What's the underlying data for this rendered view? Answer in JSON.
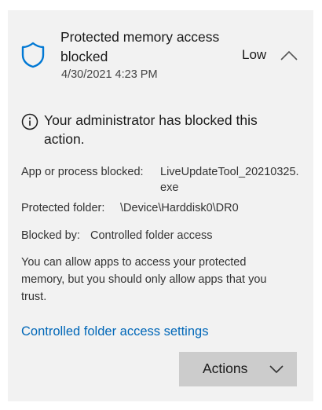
{
  "notification": {
    "title": "Protected memory access blocked",
    "timestamp": "4/30/2021 4:23 PM",
    "severity": "Low",
    "icon": "shield-icon",
    "accent_color": "#0078d4"
  },
  "notice": {
    "icon": "info-icon",
    "text": "Your administrator has blocked this action."
  },
  "details": {
    "app_label": "App or process blocked:",
    "app_value": "LiveUpdateTool_20210325.exe",
    "folder_label": "Protected folder:",
    "folder_value": "\\Device\\Harddisk0\\DR0",
    "blocked_by_label": "Blocked by:",
    "blocked_by_value": "Controlled folder access"
  },
  "advice": "You can allow apps to access your protected memory, but you should only allow apps that you trust.",
  "settings_link": "Controlled folder access settings",
  "actions": {
    "label": "Actions"
  }
}
